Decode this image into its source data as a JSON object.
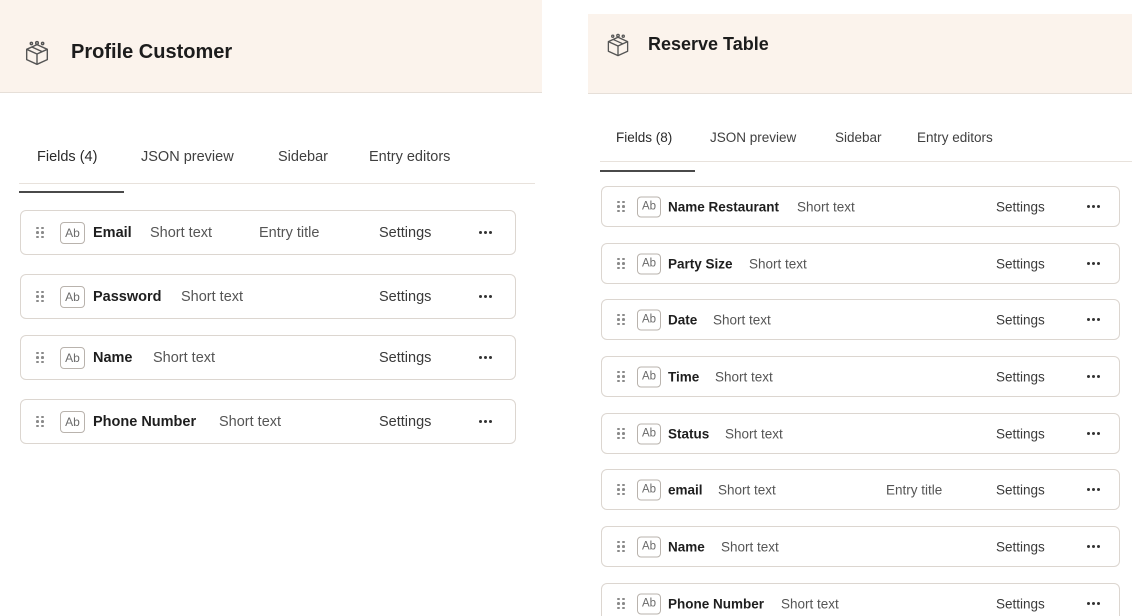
{
  "left_panel": {
    "title": "Profile Customer",
    "icon": "cube-icon",
    "tabs": [
      {
        "label": "Fields (4)",
        "active": true
      },
      {
        "label": "JSON preview",
        "active": false
      },
      {
        "label": "Sidebar",
        "active": false
      },
      {
        "label": "Entry editors",
        "active": false
      }
    ],
    "fields": [
      {
        "badge": "Ab",
        "name": "Email",
        "type": "Short text",
        "entry_title": "Entry title",
        "settings": "Settings"
      },
      {
        "badge": "Ab",
        "name": "Password",
        "type": "Short text",
        "entry_title": "",
        "settings": "Settings"
      },
      {
        "badge": "Ab",
        "name": "Name",
        "type": "Short text",
        "entry_title": "",
        "settings": "Settings"
      },
      {
        "badge": "Ab",
        "name": "Phone Number",
        "type": "Short text",
        "entry_title": "",
        "settings": "Settings"
      }
    ]
  },
  "right_panel": {
    "title": "Reserve Table",
    "icon": "cube-icon",
    "tabs": [
      {
        "label": "Fields (8)",
        "active": true
      },
      {
        "label": "JSON preview",
        "active": false
      },
      {
        "label": "Sidebar",
        "active": false
      },
      {
        "label": "Entry editors",
        "active": false
      }
    ],
    "fields": [
      {
        "badge": "Ab",
        "name": "Name Restaurant",
        "type": "Short text",
        "entry_title": "",
        "settings": "Settings"
      },
      {
        "badge": "Ab",
        "name": "Party Size",
        "type": "Short text",
        "entry_title": "",
        "settings": "Settings"
      },
      {
        "badge": "Ab",
        "name": "Date",
        "type": "Short text",
        "entry_title": "",
        "settings": "Settings"
      },
      {
        "badge": "Ab",
        "name": "Time",
        "type": "Short text",
        "entry_title": "",
        "settings": "Settings"
      },
      {
        "badge": "Ab",
        "name": "Status",
        "type": "Short text",
        "entry_title": "",
        "settings": "Settings"
      },
      {
        "badge": "Ab",
        "name": "email",
        "type": "Short text",
        "entry_title": "Entry title",
        "settings": "Settings"
      },
      {
        "badge": "Ab",
        "name": "Name",
        "type": "Short text",
        "entry_title": "",
        "settings": "Settings"
      },
      {
        "badge": "Ab",
        "name": "Phone Number",
        "type": "Short text",
        "entry_title": "",
        "settings": "Settings"
      }
    ]
  },
  "colors": {
    "header_bg": "#fbf3ec",
    "border": "#dcd6d0",
    "text_primary": "#1e1e1e",
    "text_secondary": "#555555"
  }
}
